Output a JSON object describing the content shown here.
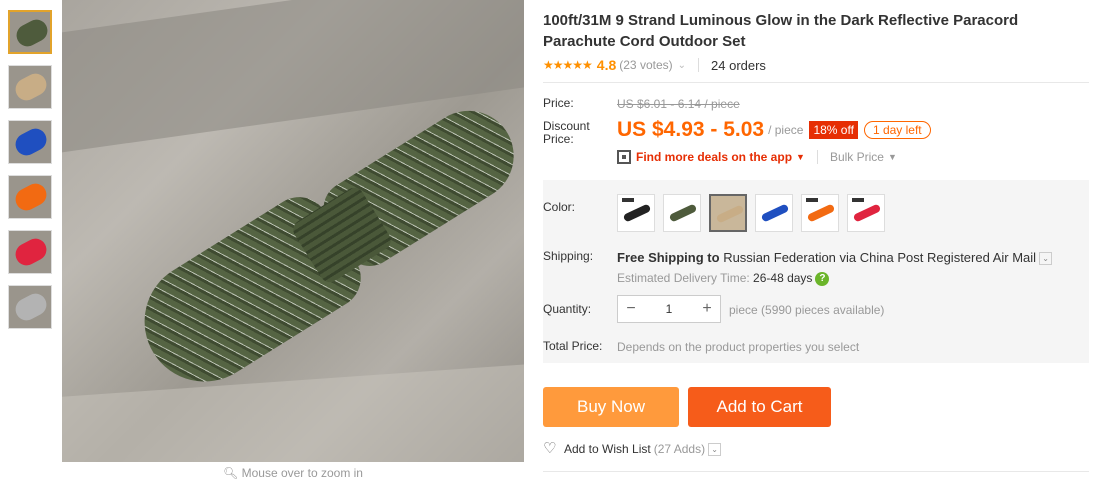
{
  "gallery": {
    "thumbnails": [
      {
        "color": "#4e5b3c"
      },
      {
        "color": "#c8ad86"
      },
      {
        "color": "#1f4fc0"
      },
      {
        "color": "#f26a12"
      },
      {
        "color": "#e0243f"
      },
      {
        "color": "#b3b3b3"
      }
    ],
    "zoom_hint": "Mouse over to zoom in"
  },
  "product": {
    "title": "100ft/31M 9 Strand Luminous Glow in the Dark Reflective Paracord Parachute Cord Outdoor Set",
    "stars": "★★★★★",
    "rating": "4.8",
    "votes": "(23 votes)",
    "orders": "24 orders"
  },
  "price": {
    "price_label": "Price:",
    "original": "US $6.01 - 6.14 / piece",
    "discount_label": "Discount Price:",
    "discount": "US $4.93 - 5.03",
    "unit": "/ piece",
    "off_badge": "18% off",
    "days_badge": "1 day left",
    "app_deals": "Find more deals on the app",
    "bulk_price": "Bulk Price"
  },
  "color": {
    "label": "Color:",
    "swatches": [
      {
        "color": "#222222"
      },
      {
        "color": "#4e5b3c"
      },
      {
        "color": "#c8ad86"
      },
      {
        "color": "#1f4fc0"
      },
      {
        "color": "#f26a12"
      },
      {
        "color": "#e0243f"
      }
    ]
  },
  "shipping": {
    "label": "Shipping:",
    "free": "Free Shipping to",
    "destination": "Russian Federation via China Post Registered Air Mail",
    "delivery_label": "Estimated Delivery Time:",
    "delivery_days": "26-48 days"
  },
  "quantity": {
    "label": "Quantity:",
    "value": "1",
    "minus": "−",
    "plus": "+",
    "available": "piece (5990 pieces available)"
  },
  "total": {
    "label": "Total Price:",
    "text": "Depends on the product properties you select"
  },
  "actions": {
    "buy_now": "Buy Now",
    "add_to_cart": "Add to Cart",
    "wish_label": "Add to Wish List",
    "wish_count": "(27 Adds)"
  }
}
